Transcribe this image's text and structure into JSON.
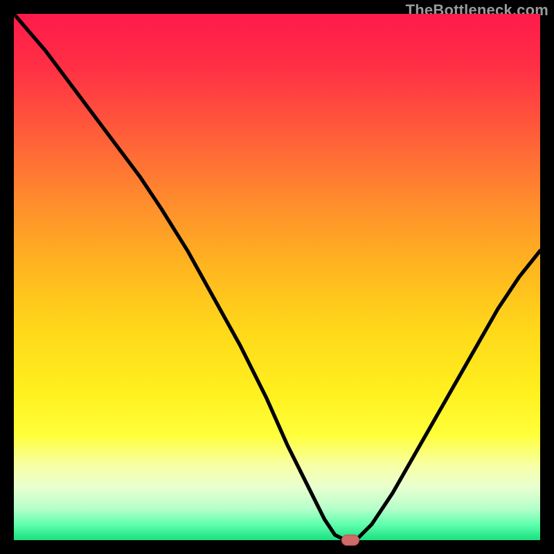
{
  "watermark": "TheBottleneck.com",
  "colors": {
    "background": "#000000",
    "curve": "#000000",
    "marker_fill": "#d36a6a",
    "marker_stroke": "#b04f4f",
    "gradient_stops": [
      {
        "offset": 0.0,
        "color": "#ff1a4b"
      },
      {
        "offset": 0.1,
        "color": "#ff2f45"
      },
      {
        "offset": 0.22,
        "color": "#ff5a3a"
      },
      {
        "offset": 0.35,
        "color": "#ff8a2e"
      },
      {
        "offset": 0.48,
        "color": "#ffb51f"
      },
      {
        "offset": 0.6,
        "color": "#ffd81a"
      },
      {
        "offset": 0.72,
        "color": "#fff01f"
      },
      {
        "offset": 0.8,
        "color": "#ffff3a"
      },
      {
        "offset": 0.86,
        "color": "#f7ffa8"
      },
      {
        "offset": 0.9,
        "color": "#e8ffd0"
      },
      {
        "offset": 0.94,
        "color": "#b6ffca"
      },
      {
        "offset": 0.97,
        "color": "#5fffad"
      },
      {
        "offset": 1.0,
        "color": "#19e07f"
      }
    ]
  },
  "chart_data": {
    "type": "line",
    "title": "",
    "xlabel": "",
    "ylabel": "",
    "xlim": [
      0,
      100
    ],
    "ylim": [
      0,
      100
    ],
    "series": [
      {
        "name": "bottleneck-curve",
        "x": [
          0,
          6,
          12,
          18,
          24,
          28,
          33,
          38,
          43,
          48,
          52,
          56,
          59,
          61,
          63,
          65,
          68,
          72,
          76,
          80,
          84,
          88,
          92,
          96,
          100
        ],
        "y": [
          100,
          93,
          85,
          77,
          69,
          63,
          55,
          46,
          37,
          27,
          18,
          10,
          4,
          1,
          0,
          0,
          3,
          9,
          16,
          23,
          30,
          37,
          44,
          50,
          55
        ]
      }
    ],
    "marker": {
      "x": 64,
      "y": 0
    }
  }
}
